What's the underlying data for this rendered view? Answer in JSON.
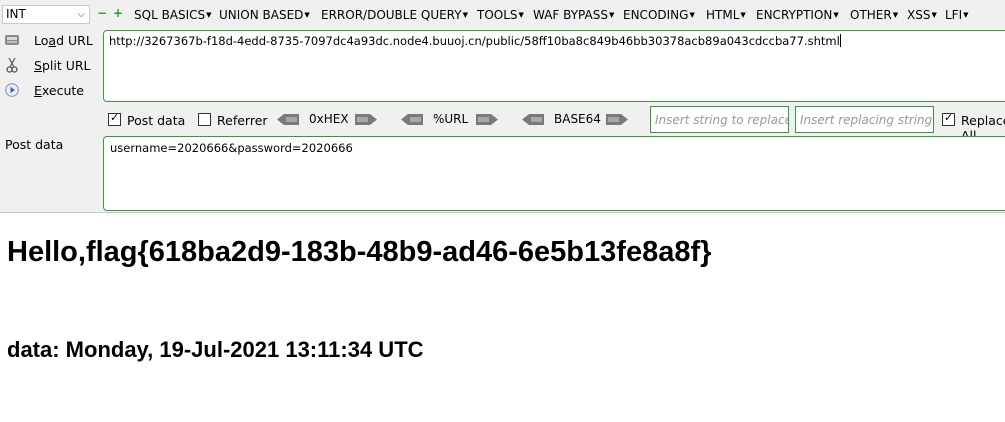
{
  "toolbar": {
    "type_select": "INT",
    "menus": [
      "SQL BASICS",
      "UNION BASED",
      "ERROR/DOUBLE QUERY",
      "TOOLS",
      "WAF BYPASS",
      "ENCODING",
      "HTML",
      "ENCRYPTION",
      "OTHER",
      "XSS",
      "LFI"
    ]
  },
  "side_buttons": {
    "load_url_pre": "Lo",
    "load_url_ul": "a",
    "load_url_post": "d URL",
    "split_url_ul": "S",
    "split_url_post": "plit URL",
    "execute_ul": "E",
    "execute_post": "xecute"
  },
  "url": {
    "value": "http://3267367b-f18d-4edd-8735-7097dc4a93dc.node4.buuoj.cn/public/58ff10ba8c849b46bb30378acb89a043cdccba77.shtml"
  },
  "options": {
    "post_data_label": "Post data",
    "post_data_checked": true,
    "referrer_label": "Referrer",
    "referrer_checked": false,
    "hex_label": "0xHEX",
    "url_label": "%URL",
    "base64_label": "BASE64",
    "replace_placeholder": "Insert string to replace",
    "replacing_placeholder": "Insert replacing string",
    "replace_all_label": "Replace All",
    "replace_all_checked": true
  },
  "post": {
    "label": "Post data",
    "value": "username=2020666&password=2020666"
  },
  "page": {
    "heading": "Hello,flag{618ba2d9-183b-48b9-ad46-6e5b13fe8a8f}",
    "date_line": "data: Monday, 19-Jul-2021 13:11:34 UTC"
  },
  "colors": {
    "toolbar_bg": "#f0f0f0",
    "input_border": "#3a9a3a",
    "plus_minus": "#2aa02a"
  }
}
